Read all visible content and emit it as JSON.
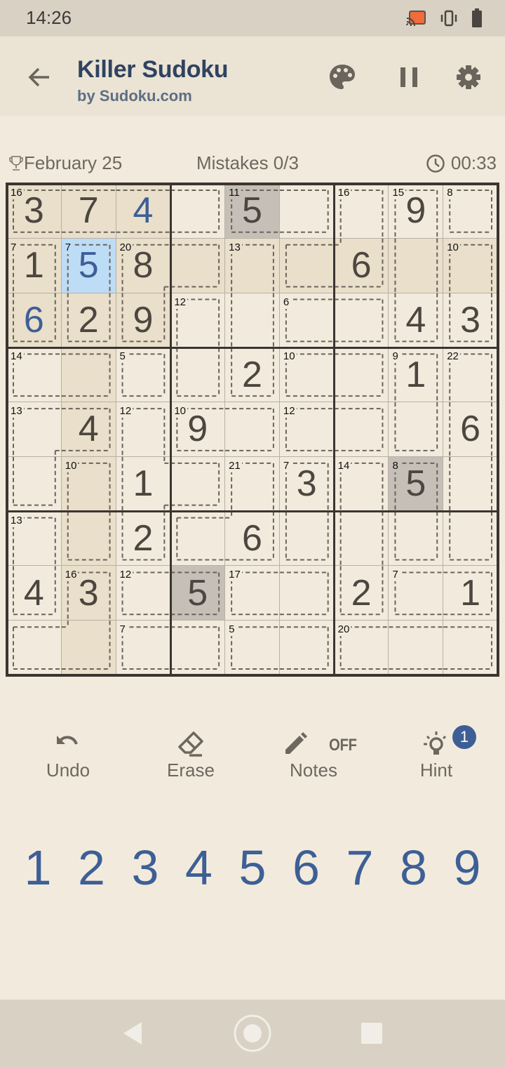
{
  "status_bar": {
    "time": "14:26",
    "icons": [
      "cast-icon",
      "vibrate-icon",
      "battery-icon"
    ],
    "cast_color": "#f26b3a"
  },
  "app_bar": {
    "title": "Killer Sudoku",
    "subtitle": "by Sudoku.com",
    "back_icon": "arrow-left-icon",
    "actions": [
      "palette-icon",
      "pause-icon",
      "gear-icon"
    ]
  },
  "info": {
    "date": "February 25",
    "mistakes": "Mistakes 0/3",
    "timer": "00:33"
  },
  "board": {
    "values": [
      [
        "3",
        "7",
        "4",
        "",
        "5",
        "",
        "",
        "9",
        ""
      ],
      [
        "1",
        "5",
        "8",
        "",
        "",
        "",
        "6",
        "",
        ""
      ],
      [
        "6",
        "2",
        "9",
        "",
        "",
        "",
        "",
        "4",
        "3"
      ],
      [
        "",
        "",
        "",
        "",
        "2",
        "",
        "",
        "1",
        ""
      ],
      [
        "",
        "4",
        "",
        "9",
        "",
        "",
        "",
        "",
        "6"
      ],
      [
        "",
        "",
        "1",
        "",
        "",
        "3",
        "",
        "5",
        ""
      ],
      [
        "",
        "",
        "2",
        "",
        "6",
        "",
        "",
        "",
        ""
      ],
      [
        "4",
        "3",
        "",
        "5",
        "",
        "",
        "2",
        "",
        "1"
      ],
      [
        "",
        "",
        "",
        "",
        "",
        "",
        "",
        "",
        ""
      ]
    ],
    "user_entered": [
      [
        0,
        2
      ],
      [
        1,
        1
      ],
      [
        2,
        0
      ]
    ],
    "selected": [
      1,
      1
    ],
    "same_number": [
      [
        0,
        4
      ],
      [
        5,
        7
      ],
      [
        7,
        3
      ]
    ],
    "cages": [
      {
        "sum": "16",
        "cells": [
          [
            0,
            0
          ],
          [
            0,
            1
          ],
          [
            0,
            2
          ],
          [
            0,
            3
          ]
        ]
      },
      {
        "sum": "11",
        "cells": [
          [
            0,
            4
          ],
          [
            0,
            5
          ]
        ]
      },
      {
        "sum": "16",
        "cells": [
          [
            0,
            6
          ],
          [
            1,
            5
          ],
          [
            1,
            6
          ]
        ]
      },
      {
        "sum": "15",
        "cells": [
          [
            0,
            7
          ],
          [
            1,
            7
          ],
          [
            2,
            7
          ]
        ]
      },
      {
        "sum": "8",
        "cells": [
          [
            0,
            8
          ]
        ]
      },
      {
        "sum": "7",
        "cells": [
          [
            1,
            0
          ],
          [
            2,
            0
          ]
        ]
      },
      {
        "sum": "7",
        "cells": [
          [
            1,
            1
          ],
          [
            2,
            1
          ]
        ]
      },
      {
        "sum": "20",
        "cells": [
          [
            1,
            2
          ],
          [
            1,
            3
          ],
          [
            2,
            2
          ]
        ]
      },
      {
        "sum": "13",
        "cells": [
          [
            1,
            4
          ],
          [
            2,
            4
          ],
          [
            3,
            4
          ]
        ]
      },
      {
        "sum": "10",
        "cells": [
          [
            1,
            8
          ],
          [
            2,
            8
          ]
        ]
      },
      {
        "sum": "12",
        "cells": [
          [
            2,
            3
          ],
          [
            3,
            3
          ]
        ]
      },
      {
        "sum": "6",
        "cells": [
          [
            2,
            5
          ],
          [
            2,
            6
          ]
        ]
      },
      {
        "sum": "14",
        "cells": [
          [
            3,
            0
          ],
          [
            3,
            1
          ]
        ]
      },
      {
        "sum": "5",
        "cells": [
          [
            3,
            2
          ]
        ]
      },
      {
        "sum": "10",
        "cells": [
          [
            3,
            5
          ],
          [
            3,
            6
          ]
        ]
      },
      {
        "sum": "9",
        "cells": [
          [
            3,
            7
          ],
          [
            4,
            7
          ]
        ]
      },
      {
        "sum": "22",
        "cells": [
          [
            3,
            8
          ],
          [
            4,
            8
          ],
          [
            5,
            8
          ],
          [
            6,
            8
          ]
        ]
      },
      {
        "sum": "13",
        "cells": [
          [
            4,
            0
          ],
          [
            4,
            1
          ],
          [
            5,
            0
          ]
        ]
      },
      {
        "sum": "12",
        "cells": [
          [
            4,
            2
          ],
          [
            5,
            2
          ],
          [
            5,
            3
          ],
          [
            6,
            2
          ]
        ]
      },
      {
        "sum": "10",
        "cells": [
          [
            4,
            3
          ],
          [
            4,
            4
          ]
        ]
      },
      {
        "sum": "12",
        "cells": [
          [
            4,
            5
          ],
          [
            4,
            6
          ]
        ]
      },
      {
        "sum": "10",
        "cells": [
          [
            5,
            1
          ],
          [
            6,
            1
          ]
        ]
      },
      {
        "sum": "21",
        "cells": [
          [
            5,
            4
          ],
          [
            6,
            3
          ],
          [
            6,
            4
          ]
        ]
      },
      {
        "sum": "7",
        "cells": [
          [
            5,
            5
          ],
          [
            6,
            5
          ]
        ]
      },
      {
        "sum": "14",
        "cells": [
          [
            5,
            6
          ],
          [
            6,
            6
          ],
          [
            7,
            6
          ]
        ]
      },
      {
        "sum": "8",
        "cells": [
          [
            5,
            7
          ],
          [
            6,
            7
          ]
        ]
      },
      {
        "sum": "13",
        "cells": [
          [
            6,
            0
          ],
          [
            7,
            0
          ]
        ]
      },
      {
        "sum": "16",
        "cells": [
          [
            7,
            1
          ],
          [
            8,
            0
          ],
          [
            8,
            1
          ]
        ]
      },
      {
        "sum": "12",
        "cells": [
          [
            7,
            2
          ],
          [
            7,
            3
          ]
        ]
      },
      {
        "sum": "17",
        "cells": [
          [
            7,
            4
          ],
          [
            7,
            5
          ]
        ]
      },
      {
        "sum": "7",
        "cells": [
          [
            7,
            7
          ],
          [
            7,
            8
          ]
        ]
      },
      {
        "sum": "7",
        "cells": [
          [
            8,
            2
          ],
          [
            8,
            3
          ]
        ]
      },
      {
        "sum": "5",
        "cells": [
          [
            8,
            4
          ],
          [
            8,
            5
          ]
        ]
      },
      {
        "sum": "20",
        "cells": [
          [
            8,
            6
          ],
          [
            8,
            7
          ],
          [
            8,
            8
          ]
        ]
      }
    ]
  },
  "tools": {
    "undo": "Undo",
    "erase": "Erase",
    "notes": "Notes",
    "notes_state": "OFF",
    "hint": "Hint",
    "hint_count": "1"
  },
  "numpad": [
    "1",
    "2",
    "3",
    "4",
    "5",
    "6",
    "7",
    "8",
    "9"
  ],
  "colors": {
    "accent": "#3e5f96",
    "selected_cell": "#bddcf6",
    "highlight_cell": "#e9dfca",
    "same_number_cell": "#c5bfb7",
    "background": "#f2ebdd"
  }
}
